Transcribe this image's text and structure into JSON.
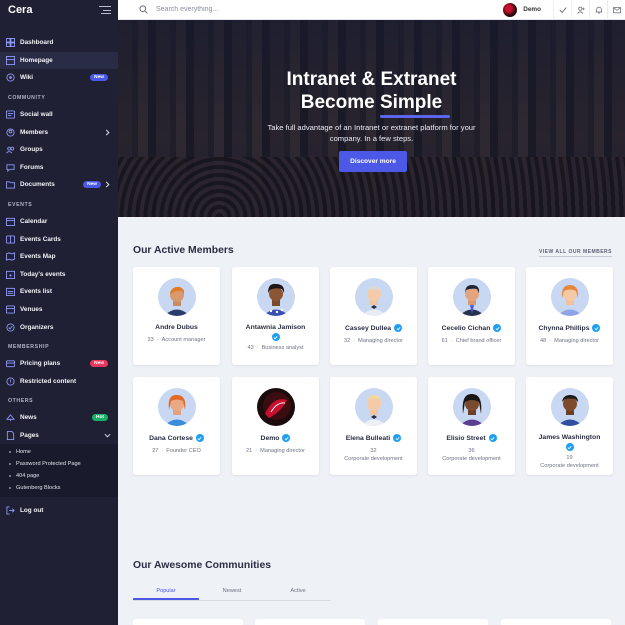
{
  "app": {
    "brand": "Cera"
  },
  "sidebar": {
    "main_items": [
      {
        "label": "Dashboard",
        "icon": "dashboard-icon",
        "active": false
      },
      {
        "label": "Homepage",
        "icon": "home-icon",
        "active": true
      },
      {
        "label": "Wiki",
        "icon": "wiki-icon",
        "badge": "New"
      }
    ],
    "community_title": "COMMUNITY",
    "community_items": [
      {
        "label": "Social wall",
        "icon": "social-wall-icon"
      },
      {
        "label": "Members",
        "icon": "members-icon",
        "chevron": true
      },
      {
        "label": "Groups",
        "icon": "groups-icon"
      },
      {
        "label": "Forums",
        "icon": "forums-icon"
      },
      {
        "label": "Documents",
        "icon": "documents-icon",
        "badge": "New",
        "chevron": true
      }
    ],
    "events_title": "EVENTS",
    "events_items": [
      {
        "label": "Calendar",
        "icon": "calendar-icon"
      },
      {
        "label": "Events Cards",
        "icon": "events-cards-icon"
      },
      {
        "label": "Events Map",
        "icon": "map-icon"
      },
      {
        "label": "Today's events",
        "icon": "today-events-icon"
      },
      {
        "label": "Events list",
        "icon": "events-list-icon"
      },
      {
        "label": "Venues",
        "icon": "venues-icon"
      },
      {
        "label": "Organizers",
        "icon": "organizers-icon"
      }
    ],
    "membership_title": "MEMBERSHIP",
    "membership_items": [
      {
        "label": "Pricing plans",
        "icon": "pricing-icon",
        "badge": "New"
      },
      {
        "label": "Restricted content",
        "icon": "lock-icon"
      }
    ],
    "others_title": "OTHERS",
    "others_items": [
      {
        "label": "News",
        "icon": "news-icon",
        "badge": "Hot"
      },
      {
        "label": "Pages",
        "icon": "pages-icon",
        "chevron": true
      }
    ],
    "pages_sub": [
      "Home",
      "Password Protected Page",
      "404 page",
      "Gutenberg Blocks"
    ],
    "logout": "Log out"
  },
  "topbar": {
    "search_placeholder": "Search everything...",
    "user_name": "Demo"
  },
  "hero": {
    "title_line1": "Intranet & Extranet",
    "title_line2": "Become Simple",
    "desc_line1": "Take full advantage of an Intranet or extranet platform for your",
    "desc_line2": "company. In a few steps.",
    "button": "Discover more"
  },
  "members_section": {
    "title": "Our Active Members",
    "view_all": "VIEW ALL OUR MEMBERS",
    "members": [
      {
        "name": "Andre Dubus",
        "count": "33",
        "role": "Account manager",
        "verified": false
      },
      {
        "name": "Antawnia Jamison",
        "count": "43",
        "role": "Business analyst",
        "verified": true
      },
      {
        "name": "Cassey Dullea",
        "count": "32",
        "role": "Managing director",
        "verified": true
      },
      {
        "name": "Cecelio Cichan",
        "count": "61",
        "role": "Chief brand officer",
        "verified": true
      },
      {
        "name": "Chynna Phillips",
        "count": "48",
        "role": "Managing director",
        "verified": true
      },
      {
        "name": "Dana Cortese",
        "count": "27",
        "role": "Founder CEO",
        "verified": true
      },
      {
        "name": "Demo",
        "count": "21",
        "role": "Managing director",
        "verified": true
      },
      {
        "name": "Elena Bulleati",
        "count": "32",
        "role": "Corporate development",
        "verified": true
      },
      {
        "name": "Elisio Street",
        "count": "36",
        "role": "Corporate development",
        "verified": true
      },
      {
        "name": "James Washington",
        "count": "19",
        "role": "Corporate development",
        "verified": true
      }
    ]
  },
  "communities_section": {
    "title": "Our Awesome Communities",
    "tabs": [
      "Popular",
      "Newest",
      "Active"
    ]
  },
  "colors": {
    "accent": "#4b59e6",
    "sidebar_bg": "#1f2033",
    "verified": "#1ea0f2",
    "hot_badge": "#17b26a",
    "new_badge_red": "#e8365d"
  }
}
